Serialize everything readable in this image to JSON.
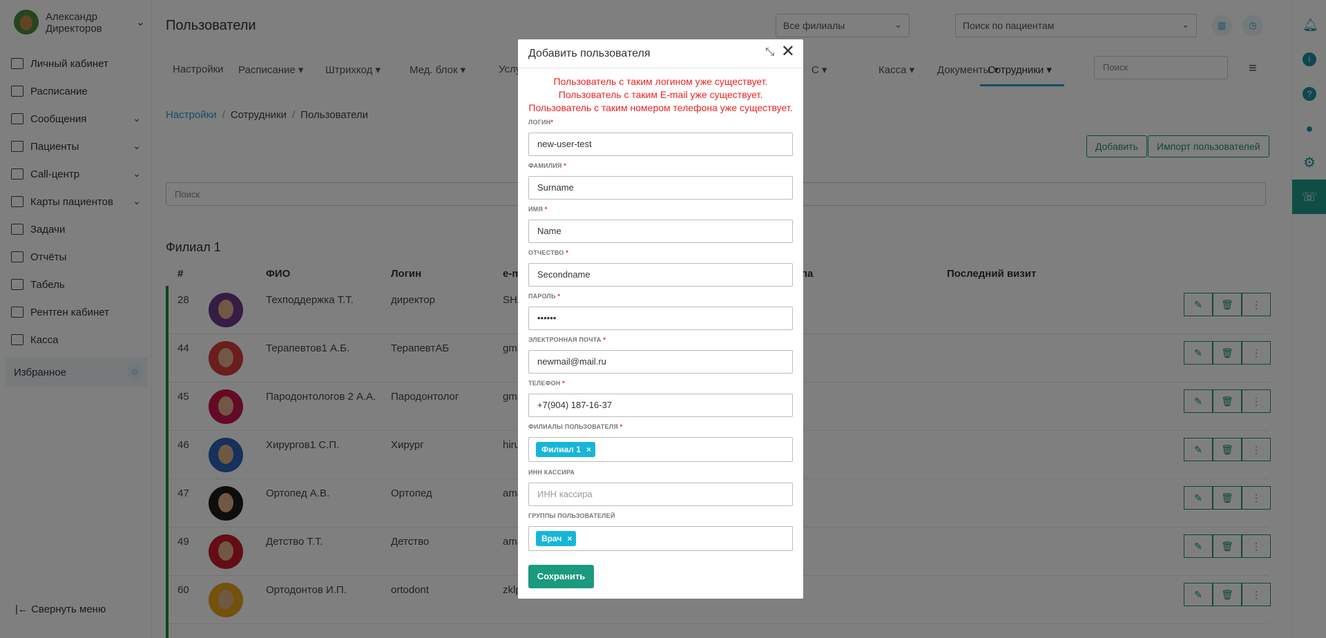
{
  "user": {
    "name_line1": "Александр",
    "name_line2": "Директоров"
  },
  "sidebar": {
    "items": [
      {
        "label": "Личный кабинет",
        "icon": "home-icon",
        "expandable": false
      },
      {
        "label": "Расписание",
        "icon": "calendar-icon",
        "expandable": false
      },
      {
        "label": "Сообщения",
        "icon": "messages-icon",
        "expandable": true
      },
      {
        "label": "Пациенты",
        "icon": "patients-icon",
        "expandable": true
      },
      {
        "label": "Call-центр",
        "icon": "phone-icon",
        "expandable": true
      },
      {
        "label": "Карты пациентов",
        "icon": "card-icon",
        "expandable": true
      },
      {
        "label": "Задачи",
        "icon": "tasks-icon",
        "expandable": false
      },
      {
        "label": "Отчёты",
        "icon": "chart-icon",
        "expandable": false
      },
      {
        "label": "Табель",
        "icon": "timesheet-icon",
        "expandable": false
      },
      {
        "label": "Рентген кабинет",
        "icon": "radiation-icon",
        "expandable": false
      },
      {
        "label": "Касса",
        "icon": "cash-icon",
        "expandable": false
      }
    ],
    "favorites": "Избранное",
    "collapse": "Свернуть меню"
  },
  "header": {
    "title": "Пользователи",
    "branch_select": "Все филиалы",
    "patient_search": "Поиск по пациентам"
  },
  "tabs": [
    {
      "label": "Настройки"
    },
    {
      "label": "Расписание ▾"
    },
    {
      "label": "Штрихкод ▾"
    },
    {
      "label": "Мед. блок ▾"
    },
    {
      "label": "Услуги"
    },
    {
      "label": "С ▾"
    },
    {
      "label": "Касса ▾"
    },
    {
      "label": "Документы ▾"
    },
    {
      "label": "Сотрудники ▾"
    }
  ],
  "tab_search_placeholder": "Поиск",
  "breadcrumb": {
    "home": "Настройки",
    "section": "Сотрудники",
    "current": "Пользователи"
  },
  "buttons": {
    "add": "Добавить",
    "import": "Импорт пользователей"
  },
  "list_search_placeholder": "Поиск",
  "branch_title": "Филиал 1",
  "table": {
    "headers": {
      "num": "#",
      "name": "ФИО",
      "login": "Логин",
      "email": "е-m",
      "group": "па",
      "last_visit": "Последний визит"
    },
    "rows": [
      {
        "num": "28",
        "name": "Техподдержка Т.Т.",
        "login": "директор",
        "email": "SHA",
        "avatar_color": "#6b3a8a"
      },
      {
        "num": "44",
        "name": "Терапевтов1 А.Б.",
        "login": "ТерапевтАБ",
        "email": "gma",
        "avatar_color": "#d83a3a"
      },
      {
        "num": "45",
        "name": "Пародонтологов 2 А.А.",
        "login": "Пародонтолог",
        "email": "gma",
        "avatar_color": "#c8154a"
      },
      {
        "num": "46",
        "name": "Хирургов1 С.П.",
        "login": "Хирург",
        "email": "hiru",
        "avatar_color": "#2a62b8"
      },
      {
        "num": "47",
        "name": "Ортопед А.В.",
        "login": "Ортопед",
        "email": "ama",
        "avatar_color": "#1a1a1a"
      },
      {
        "num": "49",
        "name": "Детство Т.Т.",
        "login": "Детство",
        "email": "ama",
        "avatar_color": "#c81a2a"
      },
      {
        "num": "60",
        "name": "Ортодонтов И.П.",
        "login": "ortodont",
        "email": "zklp",
        "avatar_color": "#e8a21a"
      }
    ]
  },
  "modal": {
    "title": "Добавить пользователя",
    "errors": [
      "Пользователь с таким логином уже существует.",
      "Пользователь с таким E-mail уже существует.",
      "Пользователь с таким номером телефона уже существует."
    ],
    "fields": {
      "login": {
        "label": "ЛОГИН",
        "value": "new-user-test"
      },
      "surname": {
        "label": "ФАМИЛИЯ",
        "value": "Surname"
      },
      "name": {
        "label": "ИМЯ",
        "value": "Name"
      },
      "patronymic": {
        "label": "ОТЧЕСТВО",
        "value": "Secondname"
      },
      "password": {
        "label": "ПАРОЛЬ",
        "value": "••••••"
      },
      "email": {
        "label": "ЭЛЕКТРОННАЯ ПОЧТА",
        "value": "newmail@mail.ru"
      },
      "phone": {
        "label": "ТЕЛЕФОН",
        "value": "+7(904) 187-16-37"
      },
      "branches": {
        "label": "ФИЛИАЛЫ ПОЛЬЗОВАТЕЛЯ",
        "tag": "Филиал 1"
      },
      "inn": {
        "label": "ИНН КАССИРА",
        "placeholder": "ИНН кассира"
      },
      "groups": {
        "label": "ГРУППЫ ПОЛЬЗОВАТЕЛЕЙ",
        "tag": "Врач"
      }
    },
    "required_mark": "*",
    "save": "Сохранить"
  },
  "colors": {
    "accent": "#2a9ccc",
    "primary": "#1a9a7e",
    "error": "#e22222",
    "tag": "#17b6d8"
  }
}
